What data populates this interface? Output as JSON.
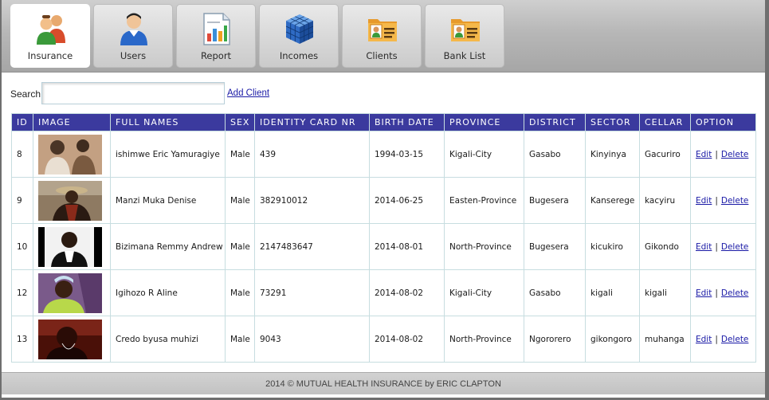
{
  "nav": {
    "tabs": [
      {
        "label": "Insurance",
        "icon": "people-group-icon",
        "active": true
      },
      {
        "label": "Users",
        "icon": "user-icon",
        "active": false
      },
      {
        "label": "Report",
        "icon": "report-chart-icon",
        "active": false
      },
      {
        "label": "Incomes",
        "icon": "cube-grid-icon",
        "active": false
      },
      {
        "label": "Clients",
        "icon": "contact-card-icon",
        "active": false
      },
      {
        "label": "Bank List",
        "icon": "contact-card-icon",
        "active": false
      }
    ]
  },
  "search": {
    "label": "Search",
    "value": "",
    "add_link": "Add Client"
  },
  "table": {
    "headers": [
      "ID",
      "IMAGE",
      "FULL NAMES",
      "SEX",
      "IDENTITY CARD NR",
      "BIRTH DATE",
      "PROVINCE",
      "DISTRICT",
      "SECTOR",
      "CELLAR",
      "OPTION"
    ],
    "rows": [
      {
        "id": "8",
        "name": "ishimwe Eric Yamuragiye",
        "sex": "Male",
        "idcard": "439",
        "birth": "1994-03-15",
        "province": "Kigali-City",
        "district": "Gasabo",
        "sector": "Kinyinya",
        "cellar": "Gacuriro",
        "edit": "Edit",
        "sep": "|",
        "delete": "Delete"
      },
      {
        "id": "9",
        "name": "Manzi Muka Denise",
        "sex": "Male",
        "idcard": "382910012",
        "birth": "2014-06-25",
        "province": "Easten-Province",
        "district": "Bugesera",
        "sector": "Kanserege",
        "cellar": "kacyiru",
        "edit": "Edit",
        "sep": "|",
        "delete": "Delete"
      },
      {
        "id": "10",
        "name": "Bizimana Remmy Andrew",
        "sex": "Male",
        "idcard": "2147483647",
        "birth": "2014-08-01",
        "province": "North-Province",
        "district": "Bugesera",
        "sector": "kicukiro",
        "cellar": "Gikondo",
        "edit": "Edit",
        "sep": "|",
        "delete": "Delete"
      },
      {
        "id": "12",
        "name": "Igihozo R Aline",
        "sex": "Male",
        "idcard": "73291",
        "birth": "2014-08-02",
        "province": "Kigali-City",
        "district": "Gasabo",
        "sector": "kigali",
        "cellar": "kigali",
        "edit": "Edit",
        "sep": "|",
        "delete": "Delete"
      },
      {
        "id": "13",
        "name": "Credo byusa muhizi",
        "sex": "Male",
        "idcard": "9043",
        "birth": "2014-08-02",
        "province": "North-Province",
        "district": "Ngororero",
        "sector": "gikongoro",
        "cellar": "muhanga",
        "edit": "Edit",
        "sep": "|",
        "delete": "Delete"
      }
    ]
  },
  "footer": {
    "text": "2014 © MUTUAL HEALTH INSURANCE by ERIC CLAPTON"
  },
  "colors": {
    "header_bg": "#3b3a9e",
    "link": "#1a1aa6",
    "border": "#c7dde0"
  }
}
